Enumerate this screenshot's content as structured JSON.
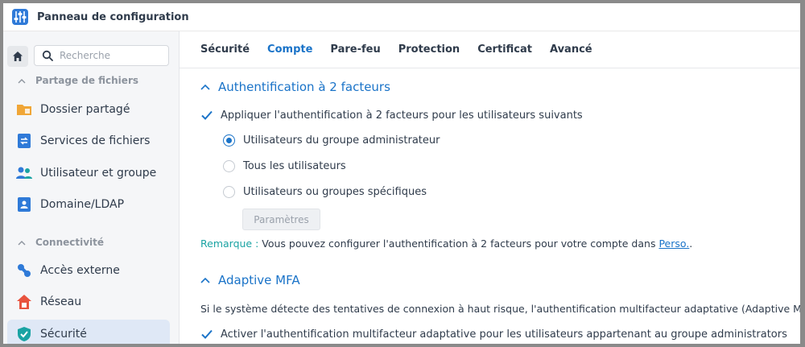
{
  "window": {
    "title": "Panneau de configuration"
  },
  "sidebar": {
    "search_placeholder": "Recherche",
    "sections": [
      {
        "label": "Partage de fichiers",
        "items": [
          {
            "label": "Dossier partagé",
            "icon": "shared-folder-icon"
          },
          {
            "label": "Services de fichiers",
            "icon": "file-services-icon"
          },
          {
            "label": "Utilisateur et groupe",
            "icon": "user-group-icon"
          },
          {
            "label": "Domaine/LDAP",
            "icon": "domain-ldap-icon"
          }
        ]
      },
      {
        "label": "Connectivité",
        "items": [
          {
            "label": "Accès externe",
            "icon": "external-access-icon"
          },
          {
            "label": "Réseau",
            "icon": "network-icon"
          },
          {
            "label": "Sécurité",
            "icon": "security-shield-icon",
            "active": true
          }
        ]
      }
    ]
  },
  "tabs": [
    {
      "label": "Sécurité"
    },
    {
      "label": "Compte",
      "active": true
    },
    {
      "label": "Pare-feu"
    },
    {
      "label": "Protection"
    },
    {
      "label": "Certificat"
    },
    {
      "label": "Avancé"
    }
  ],
  "twofa": {
    "title": "Authentification à 2 facteurs",
    "apply_label": "Appliquer l'authentification à 2 facteurs pour les utilisateurs suivants",
    "apply_checked": true,
    "options": [
      {
        "label": "Utilisateurs du groupe administrateur",
        "selected": true
      },
      {
        "label": "Tous les utilisateurs",
        "selected": false
      },
      {
        "label": "Utilisateurs ou groupes spécifiques",
        "selected": false
      }
    ],
    "params_button": "Paramètres",
    "note_label": "Remarque :",
    "note_text": " Vous pouvez configurer l'authentification à 2 facteurs pour votre compte dans ",
    "note_link": "Perso.",
    "note_end": "."
  },
  "mfa": {
    "title": "Adaptive MFA",
    "description": "Si le système détecte des tentatives de connexion à haut risque, l'authentification multifacteur adaptative (Adaptive MFA)",
    "enable_label": "Activer l'authentification multifacteur adaptative pour les utilisateurs appartenant au groupe administrators",
    "enable_checked": true
  },
  "colors": {
    "accent": "#1a73c8",
    "active_bg": "#dfe8f6",
    "note_label": "#1aa3a3"
  }
}
